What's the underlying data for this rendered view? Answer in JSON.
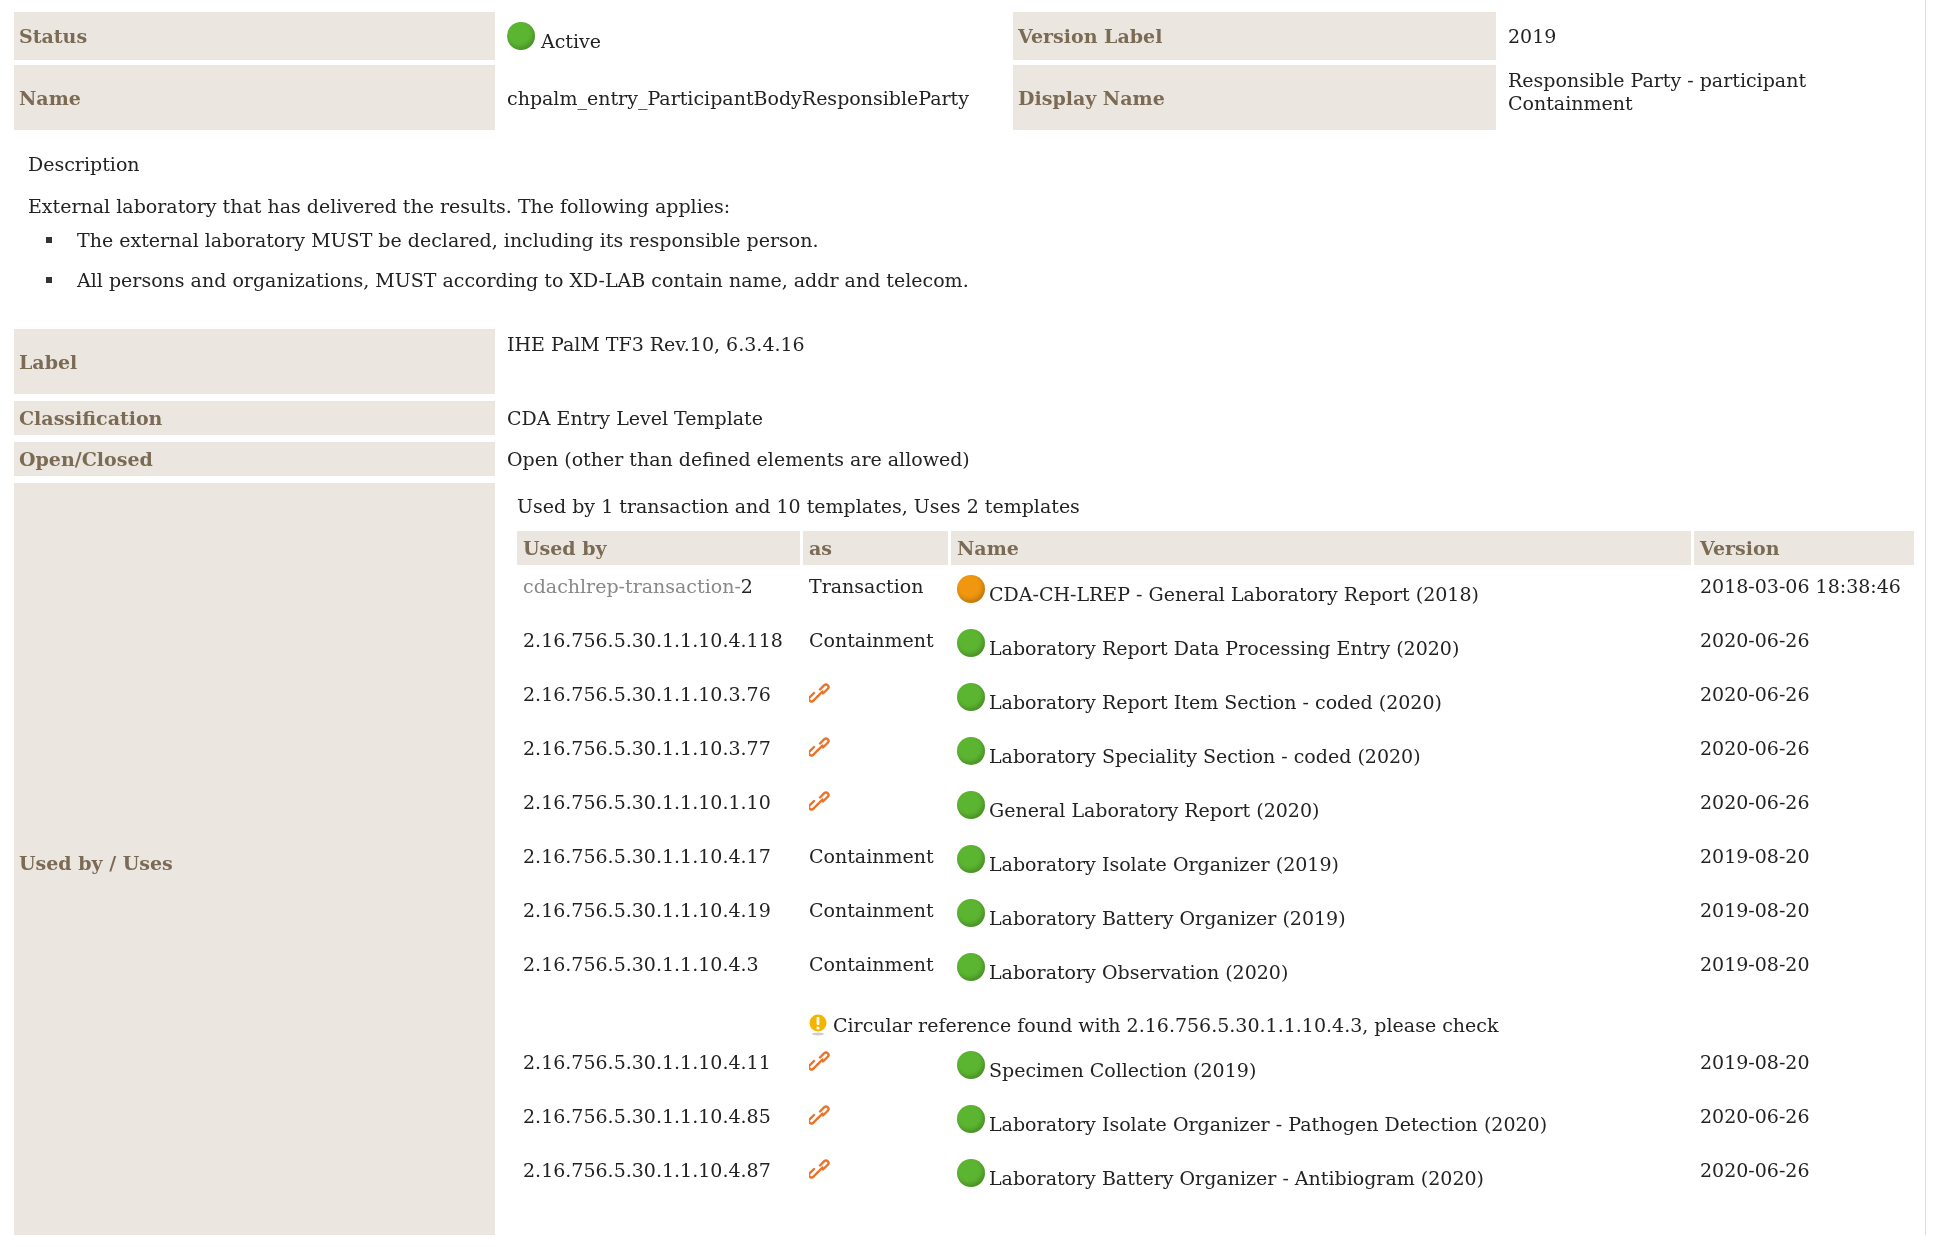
{
  "status": {
    "label": "Status",
    "value": "Active",
    "color": "#5cb531"
  },
  "version_label": {
    "label": "Version Label",
    "value": "2019"
  },
  "name": {
    "label": "Name",
    "value": "chpalm_entry_ParticipantBodyResponsibleParty"
  },
  "display_name": {
    "label": "Display Name",
    "value": "Responsible Party - participant Containment"
  },
  "description": {
    "heading": "Description",
    "intro": "External laboratory that has delivered the results. The following applies:",
    "bullets": [
      "The external laboratory MUST be declared, including its responsible person.",
      "All persons and organizations, MUST according to XD-LAB contain name, addr and telecom."
    ]
  },
  "label": {
    "label": "Label",
    "value": "IHE PalM TF3 Rev.10, 6.3.4.16"
  },
  "classification": {
    "label": "Classification",
    "value": "CDA Entry Level Template"
  },
  "open_closed": {
    "label": "Open/Closed",
    "value": "Open (other than defined elements are allowed)"
  },
  "used_by": {
    "label": "Used by / Uses",
    "summary": "Used by 1 transaction and 10 templates, Uses 2 templates",
    "table": {
      "columns": [
        "Used by",
        "as",
        "Name",
        "Version"
      ],
      "rows": [
        {
          "kind": "transaction",
          "used_by_link": "cdachlrep-transaction-",
          "used_by": "2",
          "as": "Transaction",
          "name": "CDA-CH-LREP - General Laboratory Report (2018)",
          "color": "#f0960f",
          "version": "2018-03-06 18:38:46"
        },
        {
          "kind": "template",
          "used_by": "2.16.756.5.30.1.1.10.4.118",
          "as": "Containment",
          "name": "Laboratory Report Data Processing Entry (2020)",
          "color": "#5cb531",
          "version": "2020-06-26"
        },
        {
          "kind": "link",
          "used_by": "2.16.756.5.30.1.1.10.3.76",
          "name": "Laboratory Report Item Section - coded (2020)",
          "color": "#5cb531",
          "version": "2020-06-26"
        },
        {
          "kind": "link",
          "used_by": "2.16.756.5.30.1.1.10.3.77",
          "name": "Laboratory Speciality Section - coded (2020)",
          "color": "#5cb531",
          "version": "2020-06-26"
        },
        {
          "kind": "link",
          "used_by": "2.16.756.5.30.1.1.10.1.10",
          "name": "General Laboratory Report (2020)",
          "color": "#5cb531",
          "version": "2020-06-26"
        },
        {
          "kind": "template",
          "used_by": "2.16.756.5.30.1.1.10.4.17",
          "as": "Containment",
          "name": "Laboratory Isolate Organizer (2019)",
          "color": "#5cb531",
          "version": "2019-08-20"
        },
        {
          "kind": "template",
          "used_by": "2.16.756.5.30.1.1.10.4.19",
          "as": "Containment",
          "name": "Laboratory Battery Organizer (2019)",
          "color": "#5cb531",
          "version": "2019-08-20"
        },
        {
          "kind": "template",
          "used_by": "2.16.756.5.30.1.1.10.4.3",
          "as": "Containment",
          "name": "Laboratory Observation (2020)",
          "color": "#5cb531",
          "version": "2019-08-20"
        },
        {
          "kind": "warning",
          "message": "Circular reference found with 2.16.756.5.30.1.1.10.4.3, please check"
        },
        {
          "kind": "link",
          "used_by": "2.16.756.5.30.1.1.10.4.11",
          "name": "Specimen Collection (2019)",
          "color": "#5cb531",
          "version": "2019-08-20"
        },
        {
          "kind": "link",
          "used_by": "2.16.756.5.30.1.1.10.4.85",
          "name": "Laboratory Isolate Organizer - Pathogen Detection (2020)",
          "color": "#5cb531",
          "version": "2020-06-26"
        },
        {
          "kind": "link",
          "used_by": "2.16.756.5.30.1.1.10.4.87",
          "name": "Laboratory Battery Organizer - Antibiogram (2020)",
          "color": "#5cb531",
          "version": "2020-06-26"
        }
      ]
    }
  }
}
